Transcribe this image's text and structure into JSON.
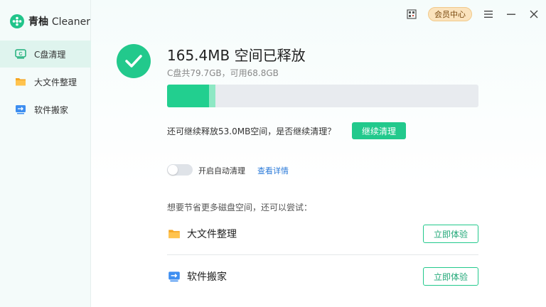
{
  "app": {
    "logo_cn": "青柚",
    "logo_en": "Cleaner"
  },
  "sidebar": {
    "items": [
      {
        "label": "C盘清理",
        "icon": "c-drive-icon",
        "active": true
      },
      {
        "label": "大文件整理",
        "icon": "folder-icon",
        "active": false
      },
      {
        "label": "软件搬家",
        "icon": "software-move-icon",
        "active": false
      }
    ]
  },
  "titlebar": {
    "vip_label": "会员中心",
    "icons": [
      "qr-code-icon",
      "menu-icon",
      "minimize-icon",
      "close-icon"
    ]
  },
  "result": {
    "headline": "165.4MB 空间已释放",
    "subline": "C盘共79.7GB，可用68.8GB",
    "progress_fraction": 0.135,
    "progress_secondary_fraction": 0.02,
    "continue_text": "还可继续释放53.0MB空间，是否继续清理？",
    "continue_button": "继续清理"
  },
  "auto_clean": {
    "toggle_on": false,
    "label": "开启自动清理",
    "details_link": "查看详情"
  },
  "suggestions": {
    "title": "想要节省更多磁盘空间，还可以尝试：",
    "items": [
      {
        "label": "大文件整理",
        "icon": "folder-icon",
        "button": "立即体验"
      },
      {
        "label": "软件搬家",
        "icon": "software-move-icon",
        "button": "立即体验"
      }
    ]
  },
  "colors": {
    "accent": "#22c98c",
    "link": "#2a7ad8",
    "vip_bg": "#fbe3bd"
  }
}
